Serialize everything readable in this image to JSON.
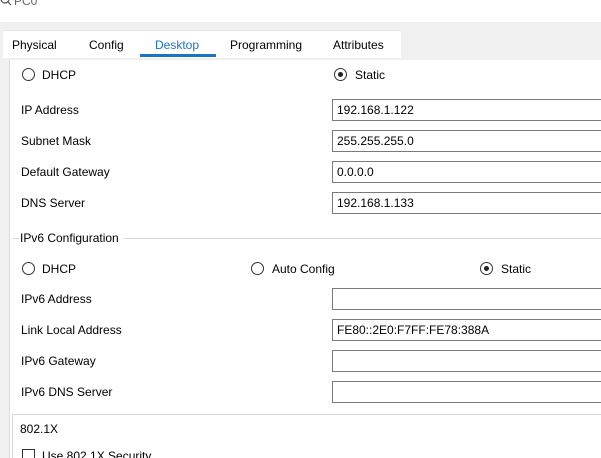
{
  "window": {
    "title": "PC0"
  },
  "tabs": [
    "Physical",
    "Config",
    "Desktop",
    "Programming",
    "Attributes"
  ],
  "ipv4": {
    "mode_options": {
      "dhcp": "DHCP",
      "static": "Static"
    },
    "selected_mode": "Static",
    "fields": {
      "ip_address": {
        "label": "IP Address",
        "value": "192.168.1.122"
      },
      "subnet_mask": {
        "label": "Subnet Mask",
        "value": "255.255.255.0"
      },
      "default_gateway": {
        "label": "Default Gateway",
        "value": "0.0.0.0"
      },
      "dns_server": {
        "label": "DNS Server",
        "value": "192.168.1.133"
      }
    }
  },
  "ipv6": {
    "group_title": "IPv6 Configuration",
    "mode_options": {
      "dhcp": "DHCP",
      "auto_config": "Auto Config",
      "static": "Static"
    },
    "selected_mode": "Static",
    "fields": {
      "ipv6_address": {
        "label": "IPv6 Address",
        "value": ""
      },
      "link_local_address": {
        "label": "Link Local Address",
        "value": "FE80::2E0:F7FF:FE78:388A"
      },
      "ipv6_gateway": {
        "label": "IPv6 Gateway",
        "value": ""
      },
      "ipv6_dns_server": {
        "label": "IPv6 DNS Server",
        "value": ""
      }
    }
  },
  "dot1x": {
    "group_title": "802.1X",
    "checkbox_label": "Use 802.1X Security"
  }
}
